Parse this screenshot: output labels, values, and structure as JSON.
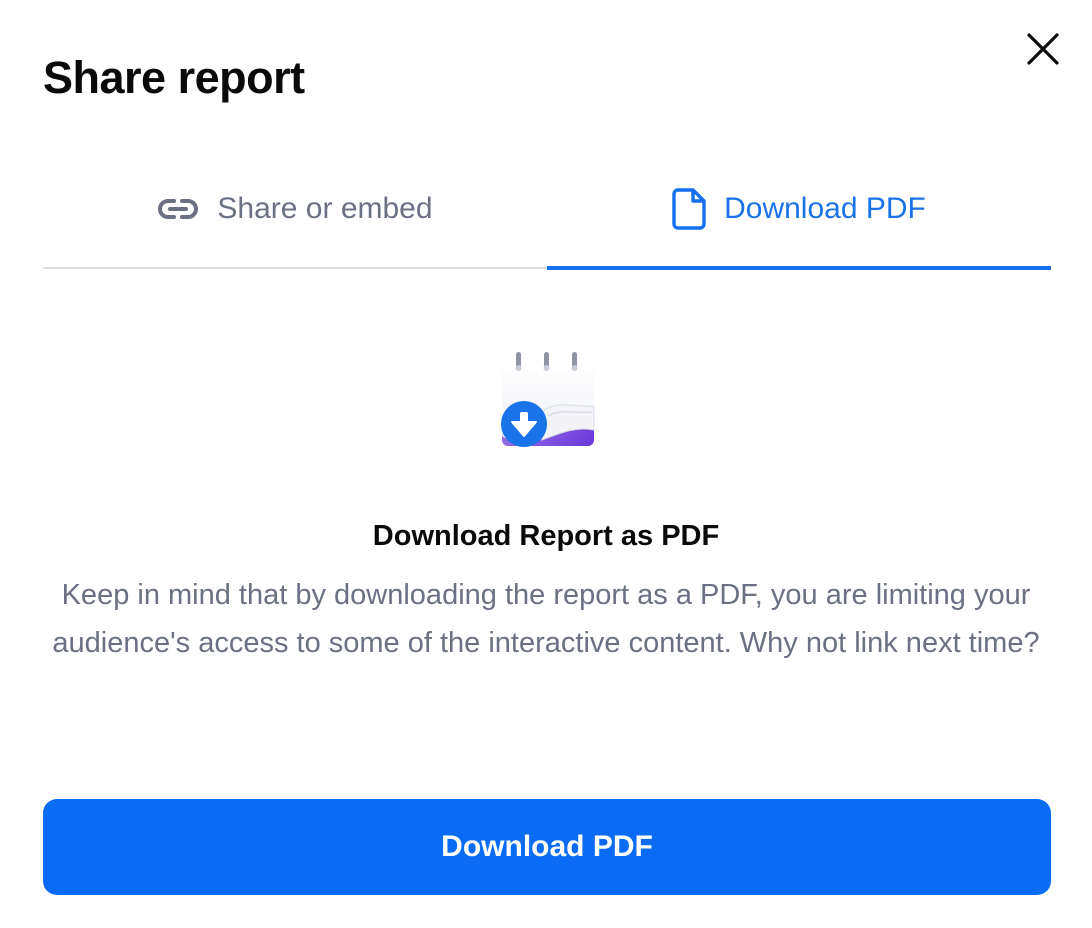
{
  "dialog": {
    "title": "Share report",
    "close_icon": "close-icon"
  },
  "tabs": [
    {
      "label": "Share or embed",
      "icon": "link-icon",
      "active": false
    },
    {
      "label": "Download PDF",
      "icon": "file-icon",
      "active": true
    }
  ],
  "content": {
    "illustration": "calendar-download-illustration",
    "heading": "Download Report as PDF",
    "body": "Keep in mind that by downloading the report as a PDF, you are limiting your audience's access to some of the interactive content. Why not link next time?"
  },
  "actions": {
    "download_label": "Download PDF"
  },
  "colors": {
    "accent": "#1570ef",
    "button": "#0a6cf5",
    "muted_text": "#6b7083"
  }
}
